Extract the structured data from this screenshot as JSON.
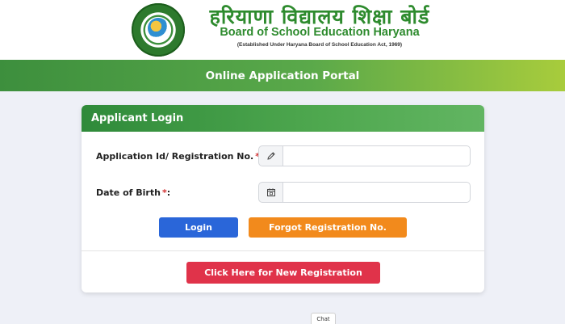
{
  "header": {
    "hindi_title": "हरियाणा विद्यालय शिक्षा बोर्ड",
    "english_title": "Board of School Education Haryana",
    "established": "(Established Under Haryana Board of School Education Act, 1969)"
  },
  "banner": {
    "title": "Online Application Portal"
  },
  "login": {
    "title": "Applicant Login",
    "app_id_label": "Application Id/ Registration No.",
    "dob_label": "Date of Birth",
    "required_mark": "*",
    "colon": ":",
    "app_id_value": "",
    "dob_value": "",
    "app_id_icon": "pencil-icon",
    "dob_icon": "calendar-icon",
    "login_button": "Login",
    "forgot_button": "Forgot Registration No.",
    "new_registration_button": "Click Here for New Registration"
  },
  "chat": {
    "label": "Chat"
  },
  "colors": {
    "brand_green": "#2e8b2e",
    "login_blue": "#2a66d9",
    "forgot_orange": "#f28a1c",
    "new_reg_red": "#e0334a",
    "required_red": "#d32f2f"
  }
}
